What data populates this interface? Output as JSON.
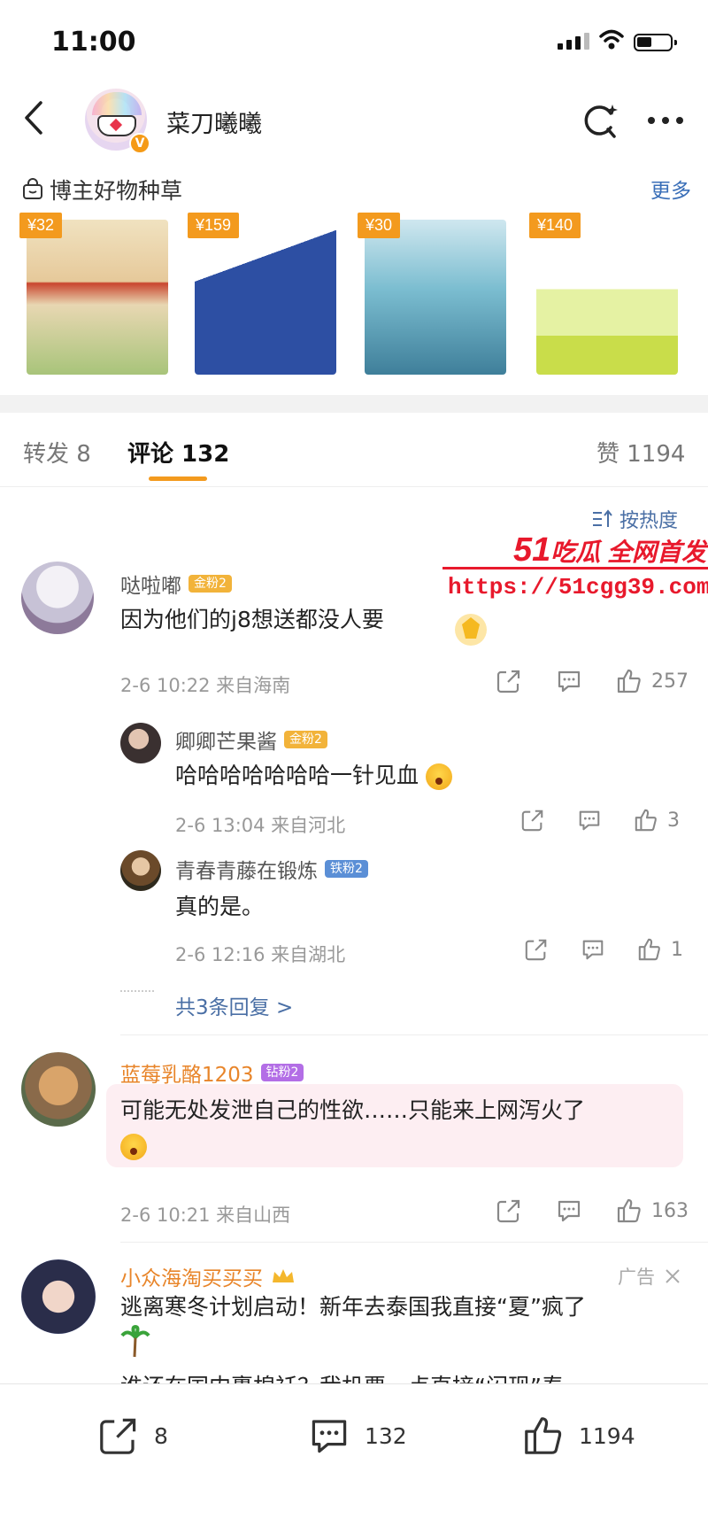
{
  "status": {
    "time": "11:00"
  },
  "nav": {
    "title": "菜刀曦曦",
    "verified_mark": "V"
  },
  "goods": {
    "title": "博主好物种草",
    "more": "更多",
    "items": [
      {
        "price": "¥32"
      },
      {
        "price": "¥159"
      },
      {
        "price": "¥30"
      },
      {
        "price": "¥140"
      }
    ]
  },
  "tabs": {
    "repost": "转发 8",
    "comment": "评论 132",
    "like": "赞 1194"
  },
  "sort": {
    "label": "按热度"
  },
  "watermark": {
    "line1_num": "51",
    "line1_text": "吃瓜 全网首发",
    "line2": "https://51cgg39.com"
  },
  "comments": [
    {
      "user": "哒啦嘟",
      "badge": "金粉2",
      "text": "因为他们的j8想送都没人要",
      "meta": "2-6 10:22 来自海南",
      "likes": "257",
      "replies": [
        {
          "user": "卿卿芒果酱",
          "badge": "金粉2",
          "text": "哈哈哈哈哈哈哈一针见血",
          "meta": "2-6 13:04 来自河北",
          "likes": "3"
        },
        {
          "user": "青春青藤在锻炼",
          "badge": "铁粉2",
          "text": "真的是。",
          "meta": "2-6 12:16 来自湖北",
          "likes": "1"
        }
      ],
      "more_replies": "共3条回复 >"
    },
    {
      "user": "蓝莓乳酪1203",
      "badge": "钻粉2",
      "text": "可能无处发泄自己的性欲……只能来上网泻火了",
      "meta": "2-6 10:21 来自山西",
      "likes": "163"
    },
    {
      "user": "小众海淘买买买",
      "ad": "广告",
      "text": "逃离寒冬计划启动！新年去泰国我直接“夏”疯了",
      "text2": "谁还在国内裹棉袄？我机票一点直接“闪现”春"
    }
  ],
  "bottom": {
    "repost": "8",
    "comment": "132",
    "like": "1194"
  }
}
